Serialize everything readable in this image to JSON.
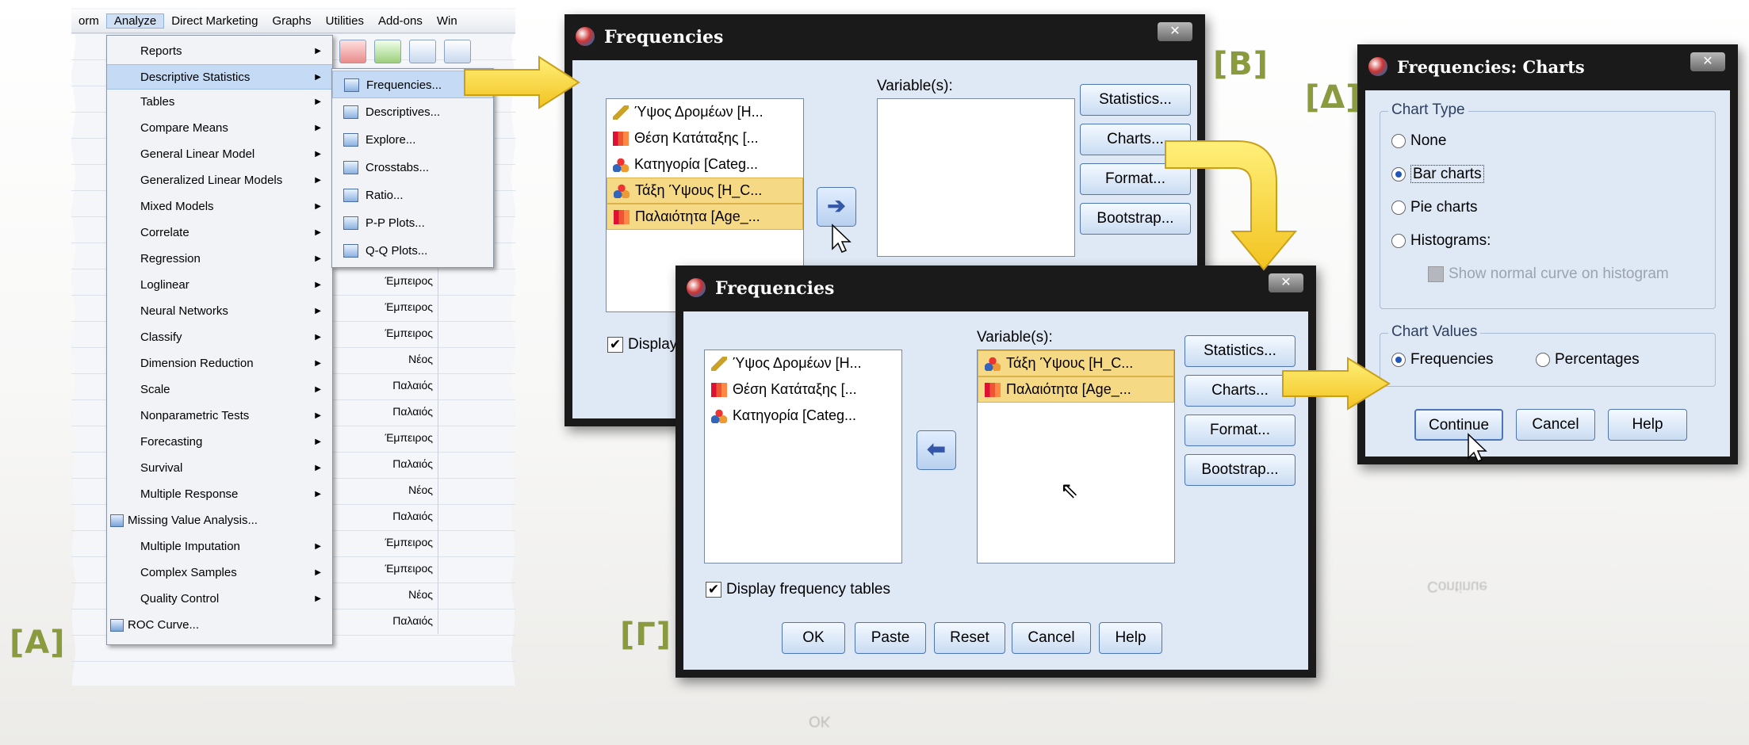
{
  "labels": {
    "a": "[A]",
    "b": "[B]",
    "g": "[Γ]",
    "d": "[Δ]"
  },
  "menubar": [
    "orm",
    "Analyze",
    "Direct Marketing",
    "Graphs",
    "Utilities",
    "Add-ons",
    "Win"
  ],
  "analyze_menu": [
    "Reports",
    "Descriptive Statistics",
    "Tables",
    "Compare Means",
    "General Linear Model",
    "Generalized Linear Models",
    "Mixed Models",
    "Correlate",
    "Regression",
    "Loglinear",
    "Neural Networks",
    "Classify",
    "Dimension Reduction",
    "Scale",
    "Nonparametric Tests",
    "Forecasting",
    "Survival",
    "Multiple Response",
    "Missing Value Analysis...",
    "Multiple Imputation",
    "Complex Samples",
    "Quality Control",
    "ROC Curve..."
  ],
  "descriptive_submenu": [
    "Frequencies...",
    "Descriptives...",
    "Explore...",
    "Crosstabs...",
    "Ratio...",
    "P-P Plots...",
    "Q-Q Plots..."
  ],
  "data_cells": [
    "Έμπειρος",
    "Έμπειρος",
    "Έμπειρος",
    "Νέος",
    "Παλαιός",
    "Παλαιός",
    "Έμπειρος",
    "Παλαιός",
    "Νέος",
    "Παλαιός",
    "Έμπειρος",
    "Έμπειρος",
    "Νέος",
    "Παλαιός"
  ],
  "freq_b": {
    "title": "Frequencies",
    "variables_label": "Variable(s):",
    "source_vars": [
      "Ύψος Δρομέων [Η...",
      "Θέση Κατάταξης [...",
      "Κατηγορία [Categ...",
      "Τάξη Ύψους [H_C...",
      "Παλαιότητα [Age_..."
    ],
    "buttons": [
      "Statistics...",
      "Charts...",
      "Format...",
      "Bootstrap..."
    ],
    "display_label": "Display"
  },
  "freq_g": {
    "title": "Frequencies",
    "variables_label": "Variable(s):",
    "source_vars": [
      "Ύψος Δρομέων [Η...",
      "Θέση Κατάταξης [...",
      "Κατηγορία [Categ..."
    ],
    "target_vars": [
      "Τάξη Ύψους [H_C...",
      "Παλαιότητα [Age_..."
    ],
    "buttons": [
      "Statistics...",
      "Charts...",
      "Format...",
      "Bootstrap..."
    ],
    "display_label": "Display frequency tables",
    "bottom_buttons": [
      "OK",
      "Paste",
      "Reset",
      "Cancel",
      "Help"
    ]
  },
  "charts_d": {
    "title": "Frequencies: Charts",
    "chart_type_label": "Chart Type",
    "chart_types": [
      "None",
      "Bar charts",
      "Pie charts",
      "Histograms:"
    ],
    "normal_curve_label": "Show normal curve on histogram",
    "chart_values_label": "Chart Values",
    "values_options": [
      "Frequencies",
      "Percentages"
    ],
    "buttons": [
      "Continue",
      "Cancel",
      "Help"
    ]
  }
}
